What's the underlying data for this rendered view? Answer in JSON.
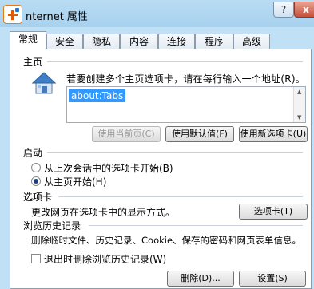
{
  "window": {
    "title": "nternet 属性",
    "help_label": "?",
    "close_label": "x"
  },
  "tabs": [
    {
      "label": "常规",
      "active": true
    },
    {
      "label": "安全"
    },
    {
      "label": "隐私"
    },
    {
      "label": "内容"
    },
    {
      "label": "连接"
    },
    {
      "label": "程序"
    },
    {
      "label": "高级"
    }
  ],
  "home": {
    "group_title": "主页",
    "description": "若要创建多个主页选项卡，请在每行输入一个地址(R)。",
    "url_value": "about:Tabs",
    "use_current_label": "使用当前页(C)",
    "use_default_label": "使用默认值(F)",
    "use_new_tab_label": "使用新选项卡(U)"
  },
  "startup": {
    "group_title": "启动",
    "option_last_session": "从上次会话中的选项卡开始(B)",
    "option_home": "从主页开始(H)",
    "selected": "home"
  },
  "tabs_group": {
    "group_title": "选项卡",
    "description": "更改网页在选项卡中的显示方式。",
    "button_label": "选项卡(T)"
  },
  "history": {
    "group_title": "浏览历史记录",
    "description": "删除临时文件、历史记录、Cookie、保存的密码和网页表单信息。",
    "checkbox_label": "退出时删除浏览历史记录(W)",
    "checkbox_checked": false,
    "delete_label": "删除(D)...",
    "settings_label": "设置(S)"
  }
}
